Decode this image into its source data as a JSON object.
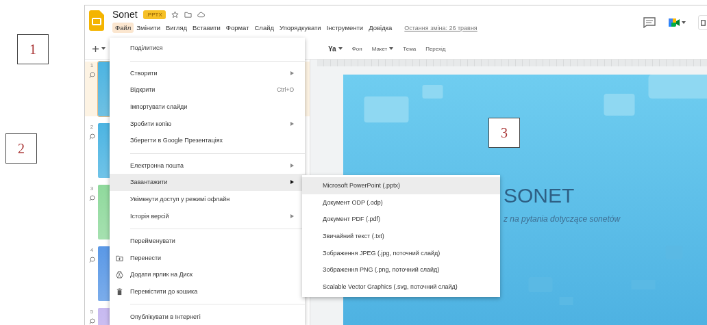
{
  "annotations": [
    {
      "label": "1"
    },
    {
      "label": "2"
    },
    {
      "label": "3"
    }
  ],
  "document": {
    "title": "Sonet",
    "badge": ".PPTX"
  },
  "menu_bar": [
    {
      "label": "Файл",
      "selected": true
    },
    {
      "label": "Змінити",
      "selected": false
    },
    {
      "label": "Вигляд",
      "selected": false
    },
    {
      "label": "Вставити",
      "selected": false
    },
    {
      "label": "Формат",
      "selected": false
    },
    {
      "label": "Слайд",
      "selected": false
    },
    {
      "label": "Упорядкувати",
      "selected": false
    },
    {
      "label": "Інструменти",
      "selected": false
    },
    {
      "label": "Довідка",
      "selected": false
    }
  ],
  "last_edit": "Остання зміна: 26 травня",
  "toolbar": [
    {
      "label": "Ya",
      "dropdown": true
    },
    {
      "label": "Фон",
      "dropdown": false
    },
    {
      "label": "Макет",
      "dropdown": true
    },
    {
      "label": "Тема",
      "dropdown": false
    },
    {
      "label": "Перехід",
      "dropdown": false
    }
  ],
  "filmstrip": [
    {
      "number": "1",
      "selected": true,
      "color": "#4cb4e2"
    },
    {
      "number": "2",
      "selected": false,
      "color": "#4cb4e2"
    },
    {
      "number": "3",
      "selected": false,
      "color": "#8fd99c"
    },
    {
      "number": "4",
      "selected": false,
      "color": "#5a98e6"
    },
    {
      "number": "5",
      "selected": false,
      "color": "#c7b9f0"
    }
  ],
  "file_menu": [
    {
      "kind": "item",
      "label": "Поділитися",
      "selected": false
    },
    {
      "kind": "divider"
    },
    {
      "kind": "item",
      "label": "Створити",
      "submenu": true,
      "selected": false
    },
    {
      "kind": "item",
      "label": "Відкрити",
      "shortcut": "Ctrl+O",
      "selected": false
    },
    {
      "kind": "item",
      "label": "Імпортувати слайди",
      "selected": false
    },
    {
      "kind": "item",
      "label": "Зробити копію",
      "submenu": true,
      "selected": false
    },
    {
      "kind": "item",
      "label": "Зберегти в Google Презентаціях",
      "selected": false
    },
    {
      "kind": "divider"
    },
    {
      "kind": "item",
      "label": "Електронна пошта",
      "submenu": true,
      "selected": false
    },
    {
      "kind": "item",
      "label": "Завантажити",
      "submenu": true,
      "selected": true
    },
    {
      "kind": "item",
      "label": "Увімкнути доступ у режимі офлайн",
      "selected": false
    },
    {
      "kind": "item",
      "label": "Історія версій",
      "submenu": true,
      "selected": false
    },
    {
      "kind": "divider"
    },
    {
      "kind": "item",
      "label": "Перейменувати",
      "selected": false
    },
    {
      "kind": "item",
      "label": "Перенести",
      "has_icon": true,
      "selected": false
    },
    {
      "kind": "item",
      "label": "Додати ярлик на Диск",
      "has_icon": true,
      "selected": false
    },
    {
      "kind": "item",
      "label": "Перемістити до кошика",
      "has_icon": true,
      "selected": false
    },
    {
      "kind": "divider"
    },
    {
      "kind": "item",
      "label": "Опублікувати в Інтернеті",
      "selected": false
    }
  ],
  "download_menu": [
    {
      "label": "Microsoft PowerPoint (.pptx)",
      "selected": true
    },
    {
      "label": "Документ ODP (.odp)",
      "selected": false
    },
    {
      "label": "Документ PDF (.pdf)",
      "selected": false
    },
    {
      "label": "Звичайний текст (.txt)",
      "selected": false
    },
    {
      "label": "Зображення JPEG (.jpg, поточний слайд)",
      "selected": false
    },
    {
      "label": "Зображення PNG (.png, поточний слайд)",
      "selected": false
    },
    {
      "label": "Scalable Vector Graphics (.svg, поточний слайд)",
      "selected": false
    }
  ],
  "slide": {
    "title": "SONET",
    "subtitle": "z na pytania dotyczące sonetów"
  }
}
